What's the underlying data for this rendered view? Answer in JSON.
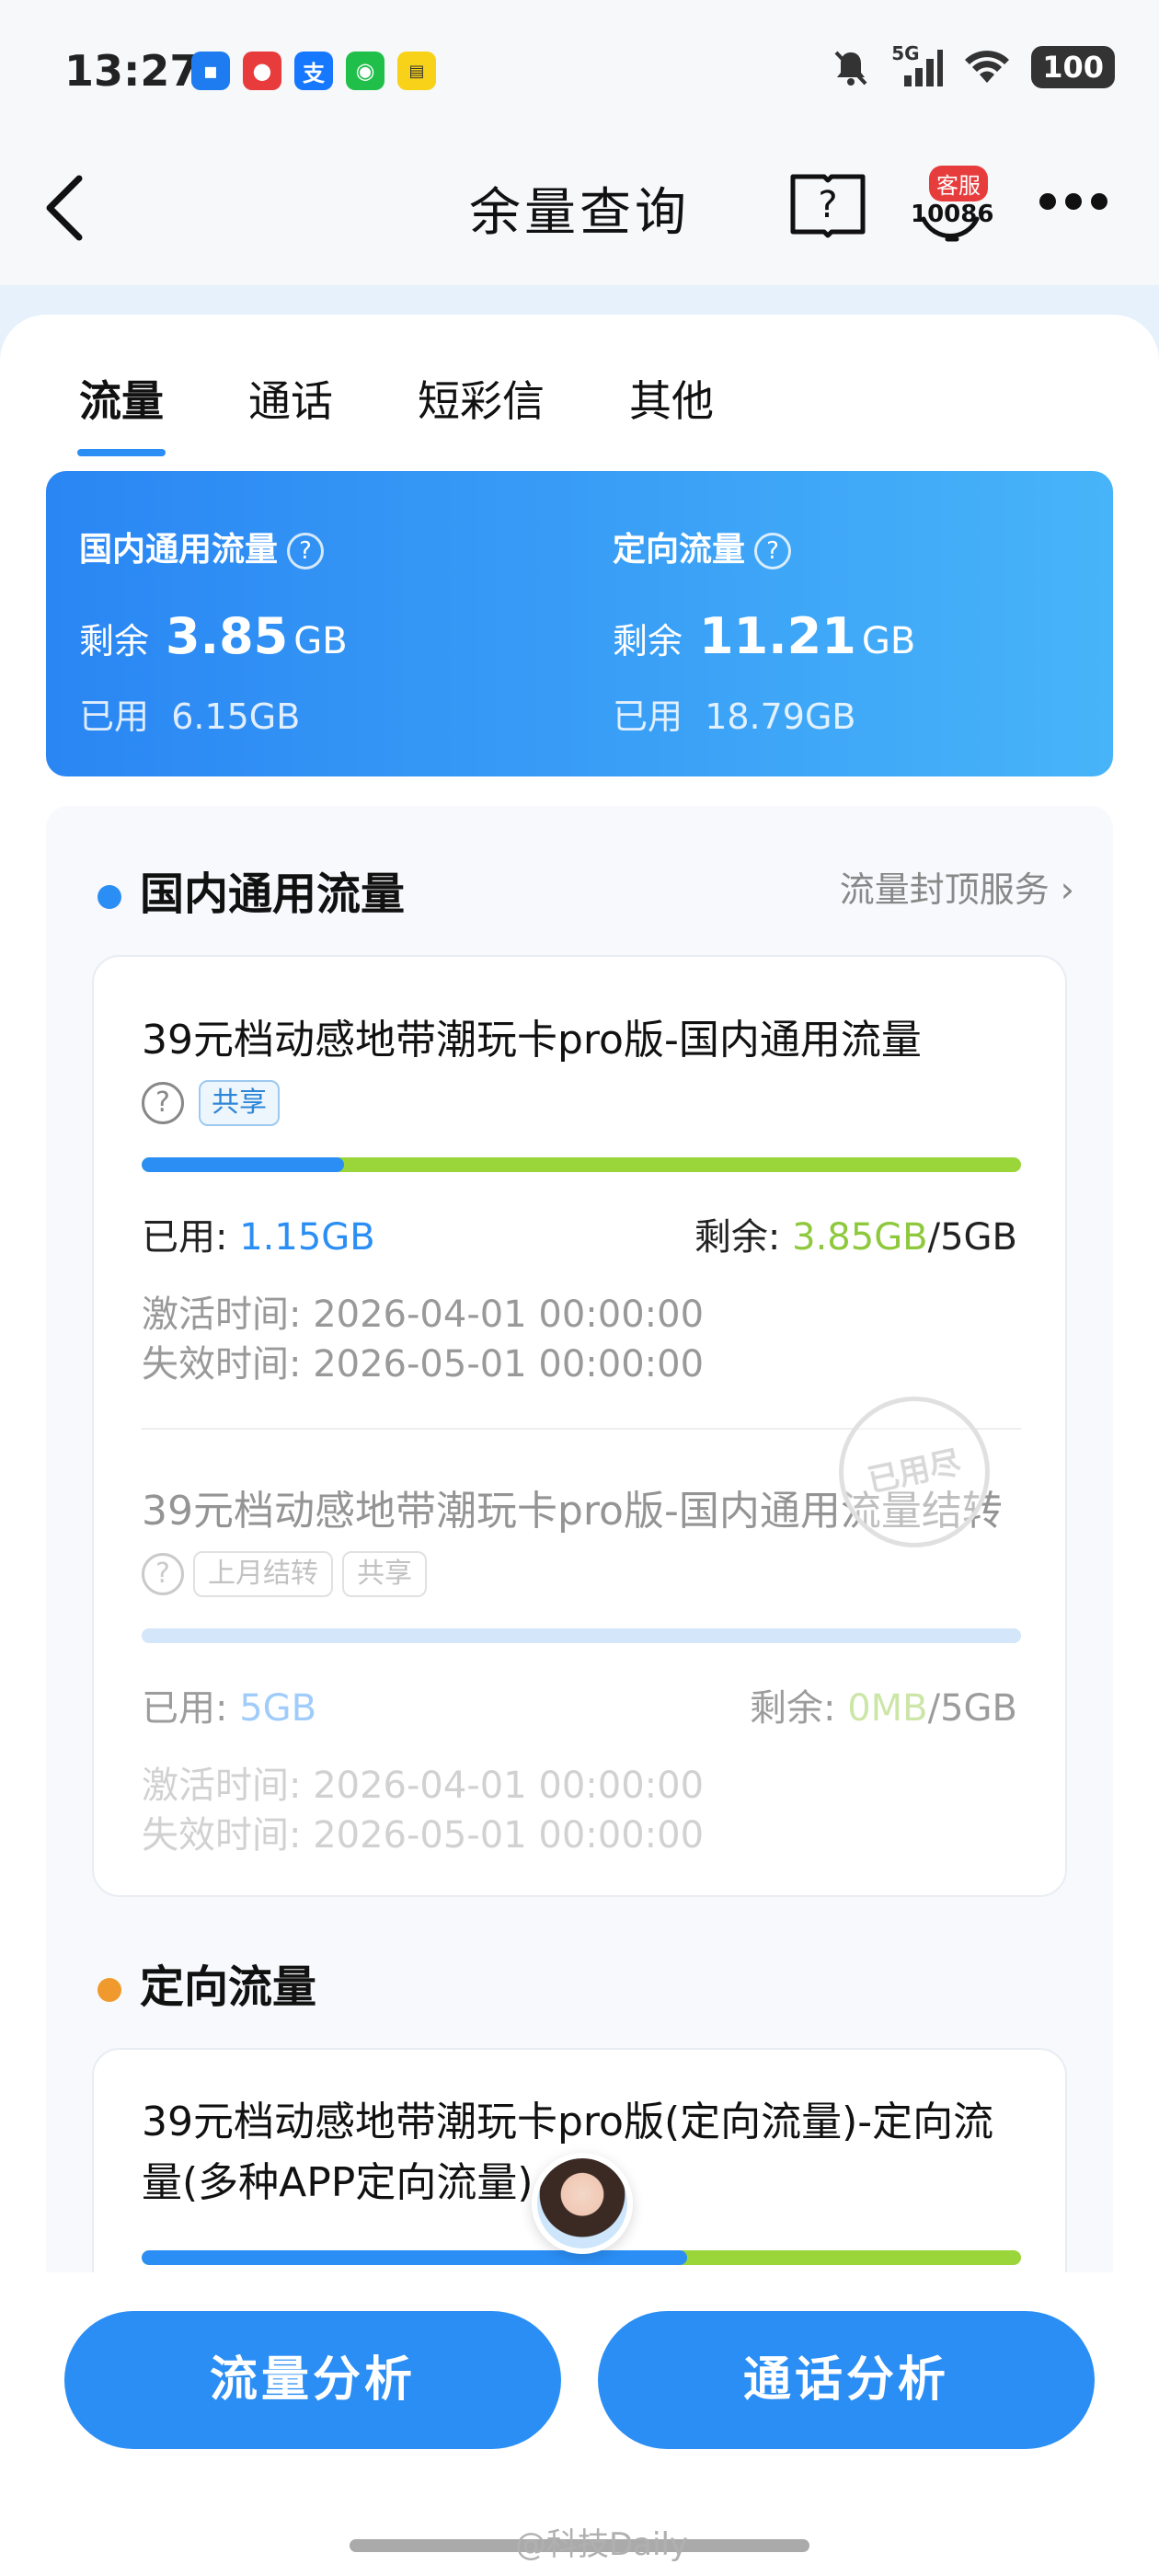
{
  "status": {
    "time": "13:27",
    "network": "5G",
    "battery": "100"
  },
  "header": {
    "title": "余量查询",
    "service_badge": "客服",
    "service_number": "10086"
  },
  "tabs": [
    {
      "label": "流量",
      "active": true
    },
    {
      "label": "通话",
      "active": false
    },
    {
      "label": "短彩信",
      "active": false
    },
    {
      "label": "其他",
      "active": false
    }
  ],
  "summary": {
    "general": {
      "title": "国内通用流量",
      "remaining_label": "剩余",
      "remaining": "3.85",
      "unit": "GB",
      "used_label": "已用",
      "used": "6.15GB"
    },
    "directed": {
      "title": "定向流量",
      "remaining_label": "剩余",
      "remaining": "11.21",
      "unit": "GB",
      "used_label": "已用",
      "used": "18.79GB"
    }
  },
  "section_general": {
    "title": "国内通用流量",
    "link": "流量封顶服务 ›"
  },
  "card1": {
    "pkg1": {
      "title": "39元档动感地带潮玩卡pro版-国内通用流量",
      "tag": "共享",
      "used_fraction": 0.23,
      "used_label": "已用:",
      "used_value": "1.15GB",
      "remain_label": "剩余:",
      "remain_value": "3.85GB",
      "remain_total": "/5GB",
      "activate": "激活时间: 2026-04-01 00:00:00",
      "expire": "失效时间: 2026-05-01 00:00:00"
    },
    "pkg2": {
      "title": "39元档动感地带潮玩卡pro版-国内通用流量结转",
      "tag1": "上月结转",
      "tag2": "共享",
      "stamp": "已用尽",
      "used_fraction": 1.0,
      "used_label": "已用:",
      "used_value": "5GB",
      "remain_label": "剩余:",
      "remain_value": "0MB",
      "remain_total": "/5GB",
      "activate": "激活时间: 2026-04-01 00:00:00",
      "expire": "失效时间: 2026-05-01 00:00:00"
    }
  },
  "section_directed": {
    "title": "定向流量"
  },
  "card2": {
    "title": "39元档动感地带潮玩卡pro版(定向流量)-定向流量(多种APP定向流量)",
    "used_fraction": 0.62
  },
  "buttons": {
    "left": "流量分析",
    "right": "通话分析"
  },
  "watermark": "@科技Daily",
  "colors": {
    "accent": "#2b8ef5",
    "remain_green": "#8ec83c",
    "dot_blue": "#2b8ef5",
    "dot_orange": "#f09a2e"
  }
}
